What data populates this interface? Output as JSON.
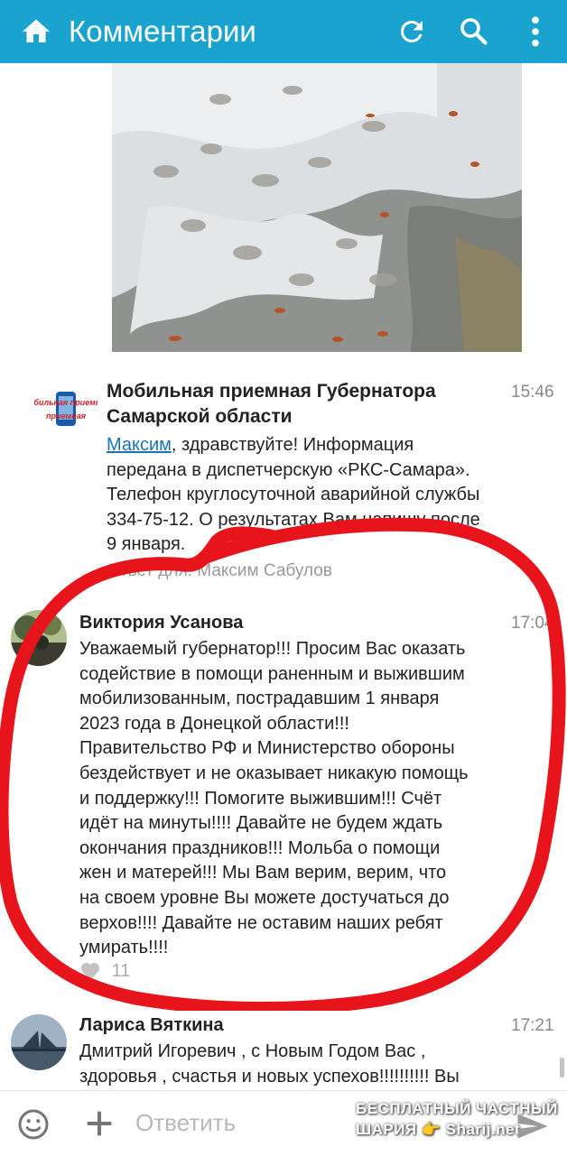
{
  "header": {
    "title": "Комментарии",
    "background": "#1aa3cf",
    "icons": [
      "home-icon",
      "refresh-icon",
      "search-icon",
      "more-vert-icon"
    ]
  },
  "comments": [
    {
      "author_line1": "Мобильная приемная Губернатора",
      "author_line2": "Самарской области",
      "time": "15:46",
      "mention": "Максим",
      "lines": [
        ", здравствуйте! Информация",
        "передана в диспетчерскую «РКС-Самара».",
        "Телефон круглосуточной аварийной службы",
        "334-75-12. О результатах Вам напишу после",
        "9 января."
      ],
      "reply_to": "Ответ для: Максим Сабулов",
      "avatar_text": "Мобильная приемная"
    },
    {
      "author": "Виктория Усанова",
      "time": "17:04",
      "lines": [
        "Уважаемый губернатор!!! Просим Вас оказать",
        "содействие в помощи раненным и выжившим",
        "мобилизованным, пострадавшим 1 января",
        "2023 года в Донецкой области!!!",
        "Правительство РФ и Министерство обороны",
        "бездействует и не оказывает никакую помощь",
        "и поддержку!!! Помогите выжившим!!! Счёт",
        "идёт на минуты!!!! Давайте не будем ждать",
        "окончания праздников!!! Мольба о помощи",
        "жен и матерей!!! Мы Вам верим, верим, что",
        "на своем уровне Вы можете достучаться до",
        "верхов!!!! Давайте не оставим наших ребят",
        "умирать!!!!"
      ],
      "likes": "11"
    },
    {
      "author": "Лариса Вяткина",
      "time": "17:21",
      "lines": [
        "Дмитрий Игоревич , с Новым Годом Вас ,",
        "здоровья , счастья и новых успехов!!!!!!!!!! Вы"
      ]
    }
  ],
  "reply": {
    "placeholder": "Ответить"
  },
  "watermark": {
    "line1": "БЕСПЛАТНЫЙ ЧАСТНЫЙ",
    "line2": "ШАРИЯ 👉 Sharij.net"
  },
  "colors": {
    "link": "#1a73b8",
    "annotation": "#e8141b"
  }
}
